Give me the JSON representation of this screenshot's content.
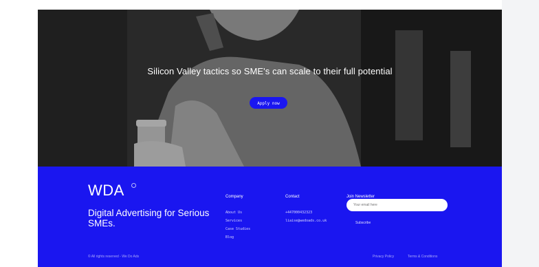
{
  "hero": {
    "title": "Silicon Valley tactics so SME's can scale to their full potential",
    "cta_label": "Apply now"
  },
  "footer": {
    "logo": "WDA",
    "tagline": "Digital Advertising for Serious SMEs.",
    "company": {
      "heading": "Company",
      "links": [
        "About Us",
        "Services",
        "Case Studies",
        "Blog"
      ]
    },
    "contact": {
      "heading": "Contact",
      "phone": "+447000432323",
      "email": "liaise@wedoads.co.uk"
    },
    "newsletter": {
      "heading": "Join Newsletter",
      "placeholder": "Your email here",
      "subscribe_label": "Subscribe"
    },
    "copyright": "© All rights reserved - We Do Ads",
    "privacy_label": "Privacy Policy",
    "terms_label": "Terms & Conditions"
  },
  "colors": {
    "brand_blue": "#1a16f0",
    "white": "#ffffff"
  }
}
